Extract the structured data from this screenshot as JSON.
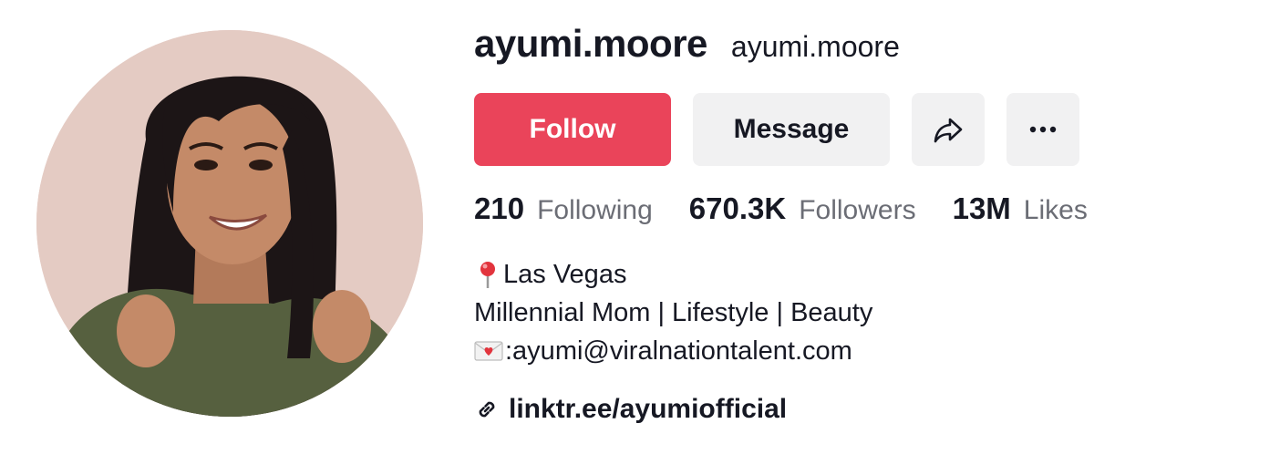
{
  "profile": {
    "username": "ayumi.moore",
    "nickname": "ayumi.moore",
    "avatar": "profile-photo"
  },
  "actions": {
    "follow_label": "Follow",
    "message_label": "Message",
    "share_icon": "share-arrow-icon",
    "more_icon": "more-dots-icon",
    "more_label": "···"
  },
  "stats": [
    {
      "value": "210",
      "label": "Following"
    },
    {
      "value": "670.3K",
      "label": "Followers"
    },
    {
      "value": "13M",
      "label": "Likes"
    }
  ],
  "bio": {
    "location": "Las Vegas",
    "location_icon": "pin-icon",
    "tagline": "Millennial Mom | Lifestyle | Beauty",
    "email": ":ayumi@viralnationtalent.com",
    "email_icon": "love-letter-icon"
  },
  "link": {
    "text": "linktr.ee/ayumiofficial",
    "icon": "link-icon"
  },
  "colors": {
    "follow_bg": "#ea445a",
    "secondary_bg": "#f1f1f2",
    "text_primary": "#161823",
    "text_secondary": "#6b6d75"
  }
}
